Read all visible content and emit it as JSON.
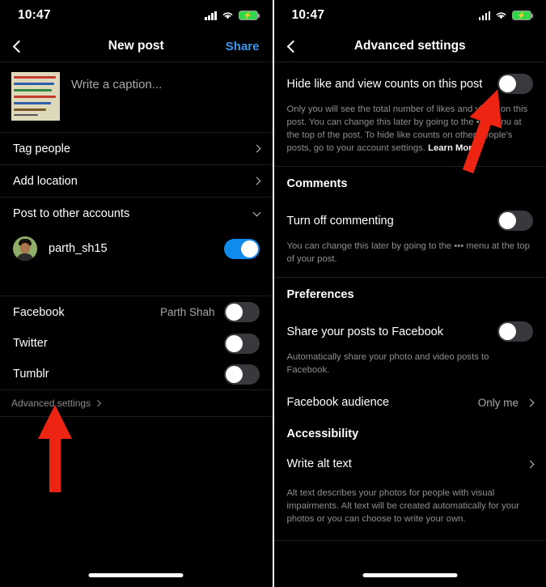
{
  "status_bar": {
    "time": "10:47",
    "signal_icon": "cellular-signal-icon",
    "wifi_icon": "wifi-icon",
    "battery_icon": "battery-charging-icon"
  },
  "left_screen": {
    "nav": {
      "back_icon": "back-chevron-icon",
      "title": "New post",
      "action_label": "Share"
    },
    "caption": {
      "placeholder": "Write a caption...",
      "thumbnail_alt": "handwritten-note-photo"
    },
    "rows": [
      {
        "label": "Tag people",
        "accessory": "chevron-right"
      },
      {
        "label": "Add location",
        "accessory": "chevron-right"
      },
      {
        "label": "Post to other accounts",
        "accessory": "chevron-down"
      }
    ],
    "account": {
      "name": "parth_sh15",
      "toggle_state": "on"
    },
    "social": [
      {
        "label": "Facebook",
        "value": "Parth Shah",
        "toggle_state": "off"
      },
      {
        "label": "Twitter",
        "value": "",
        "toggle_state": "off"
      },
      {
        "label": "Tumblr",
        "value": "",
        "toggle_state": "off"
      }
    ],
    "advanced_link": "Advanced settings"
  },
  "right_screen": {
    "nav": {
      "back_icon": "back-chevron-icon",
      "title": "Advanced settings"
    },
    "hide_counts": {
      "label": "Hide like and view counts on this post",
      "toggle_state": "off",
      "description": "Only you will see the total number of likes and views on this post. You can change this later by going to the ••• menu at the top of the post. To hide like counts on other people's posts, go to your account settings. ",
      "learn_more": "Learn More"
    },
    "comments": {
      "heading": "Comments",
      "label": "Turn off commenting",
      "toggle_state": "off",
      "description": "You can change this later by going to the ••• menu at the top of your post."
    },
    "preferences": {
      "heading": "Preferences",
      "share_label": "Share your posts to Facebook",
      "share_toggle_state": "off",
      "share_description": "Automatically share your photo and video posts to Facebook.",
      "audience_label": "Facebook audience",
      "audience_value": "Only me"
    },
    "accessibility": {
      "heading": "Accessibility",
      "alt_text_label": "Write alt text",
      "alt_text_description": "Alt text describes your photos for people with visual impairments. Alt text will be created automatically for your photos or you can choose to write your own."
    }
  },
  "annotations": {
    "left_arrow": {
      "icon": "red-arrow-up",
      "color": "#ee2412",
      "points_to": "Advanced settings"
    },
    "right_arrow": {
      "icon": "red-arrow-up-right",
      "color": "#ee2412",
      "points_to": "Hide like and view counts toggle"
    }
  },
  "home_indicator": "home-indicator-bar"
}
